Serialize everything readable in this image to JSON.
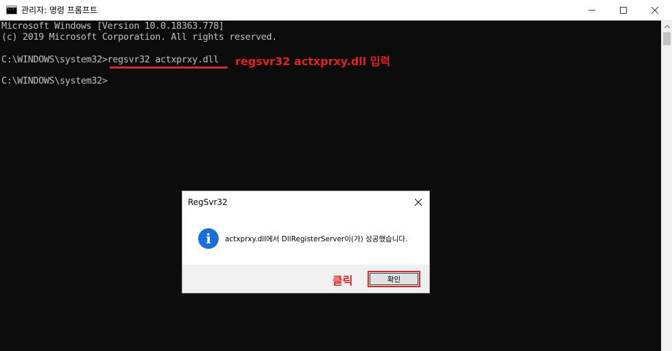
{
  "window": {
    "title": "관리자: 명령 프롬프트",
    "icon": "cmd-icon",
    "icon_text": "C:\\",
    "controls": [
      "minimize-icon",
      "maximize-icon",
      "close-icon"
    ]
  },
  "console": {
    "lines": [
      "Microsoft Windows [Version 10.0.18363.778]",
      "(c) 2019 Microsoft Corporation. All rights reserved.",
      "C:\\WINDOWS\\system32>regsvr32 actxprxy.dll",
      "C:\\WINDOWS\\system32>"
    ],
    "annotation_command": "regsvr32 actxprxy.dll 입력"
  },
  "dialog": {
    "title": "RegSvr32",
    "message": "actxprxy.dll에서 DllRegisterServer이(가) 성공했습니다.",
    "icon": "info-icon",
    "icon_glyph": "i",
    "ok_label": "확인",
    "annotation_click": "클릭"
  },
  "colors": {
    "console_bg": "#0c0c0c",
    "console_text": "#c0c0c0",
    "annotation_red": "#e02424",
    "info_blue": "#1c6fd8"
  }
}
